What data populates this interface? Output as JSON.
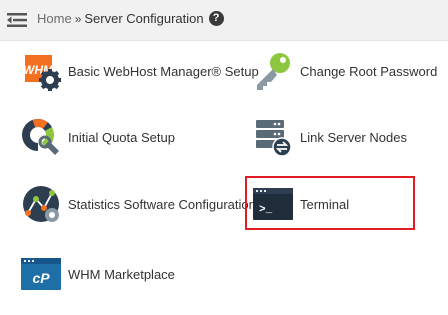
{
  "breadcrumb": {
    "home": "Home",
    "separator": "»",
    "current": "Server Configuration",
    "help": "?"
  },
  "items": [
    {
      "label": "Basic WebHost Manager® Setup",
      "icon": "whm-setup-icon"
    },
    {
      "label": "Change Root Password",
      "icon": "key-icon"
    },
    {
      "label": "Initial Quota Setup",
      "icon": "quota-icon"
    },
    {
      "label": "Link Server Nodes",
      "icon": "server-nodes-icon"
    },
    {
      "label": "Statistics Software Configuration",
      "icon": "statistics-icon"
    },
    {
      "label": "Terminal",
      "icon": "terminal-icon"
    },
    {
      "label": "WHM Marketplace",
      "icon": "cpanel-marketplace-icon"
    }
  ],
  "icon_text": {
    "whm": "WHM",
    "terminal_prompt": ">_",
    "cp": "cP"
  },
  "colors": {
    "highlight": "#e31b23",
    "whm_orange": "#f37021",
    "icon_dark": "#2c3e50",
    "key_green": "#8dc63f"
  }
}
